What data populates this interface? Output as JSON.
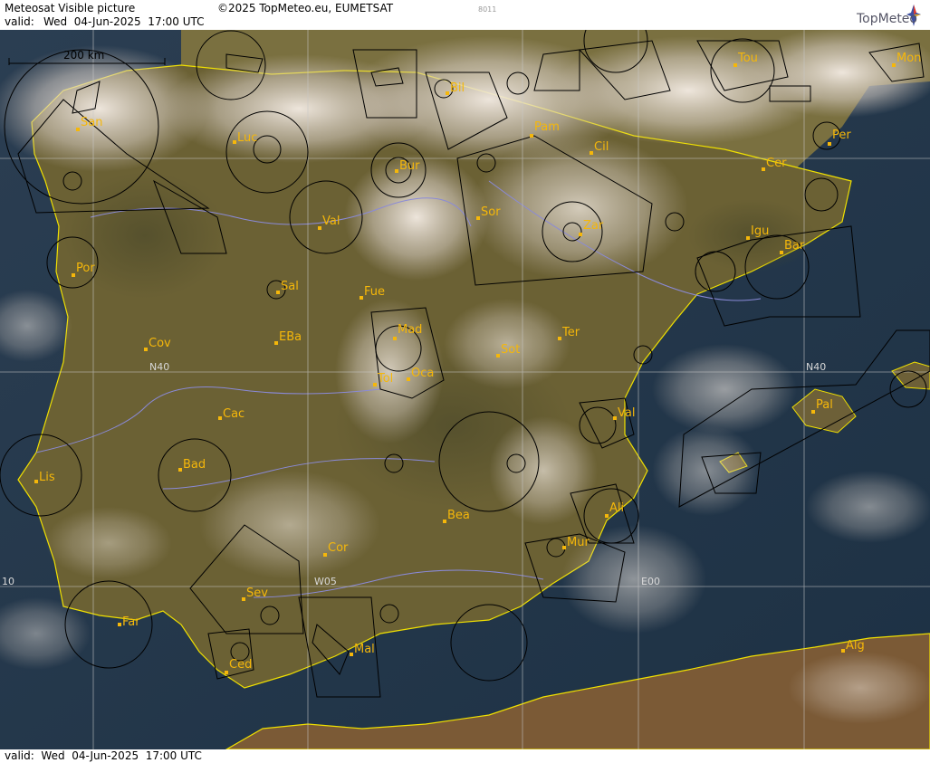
{
  "header": {
    "title": "Meteosat Visible picture",
    "copyright": "©2025 TopMeteo.eu, EUMETSAT",
    "valid_label": "valid:",
    "valid_value": "Wed  04-Jun-2025  17:00 UTC",
    "image_code": "8011",
    "logo_text": "TopMeteo"
  },
  "footer": {
    "valid_text": "valid:  Wed  04-Jun-2025  17:00 UTC"
  },
  "scale_bar": {
    "label": "200 km"
  },
  "grid_labels": {
    "lat_n40": "N40",
    "lat_n40_east": "N40",
    "lon_w05": "W05",
    "lon_e00": "E00",
    "lon_w10": "10"
  },
  "cities": [
    {
      "name": "San"
    },
    {
      "name": "Luc"
    },
    {
      "name": "Bil"
    },
    {
      "name": "Pam"
    },
    {
      "name": "Tou"
    },
    {
      "name": "Mon"
    },
    {
      "name": "Bur"
    },
    {
      "name": "Cil"
    },
    {
      "name": "Per"
    },
    {
      "name": "Cer"
    },
    {
      "name": "Val"
    },
    {
      "name": "Sor"
    },
    {
      "name": "Zar"
    },
    {
      "name": "Igu"
    },
    {
      "name": "Bar"
    },
    {
      "name": "Por"
    },
    {
      "name": "Sal"
    },
    {
      "name": "Fue"
    },
    {
      "name": "Mad"
    },
    {
      "name": "Cov"
    },
    {
      "name": "EBa"
    },
    {
      "name": "Ter"
    },
    {
      "name": "Sot"
    },
    {
      "name": "Tol"
    },
    {
      "name": "Oca"
    },
    {
      "name": "Pal"
    },
    {
      "name": "Cac"
    },
    {
      "name": "Val"
    },
    {
      "name": "Lis"
    },
    {
      "name": "Bad"
    },
    {
      "name": "Ali"
    },
    {
      "name": "Bea"
    },
    {
      "name": "Mur"
    },
    {
      "name": "Cor"
    },
    {
      "name": "Sev"
    },
    {
      "name": "Far"
    },
    {
      "name": "Mal"
    },
    {
      "name": "Ced"
    },
    {
      "name": "Alg"
    }
  ],
  "colors": {
    "sea": "#1f3446",
    "land": "#6e6336",
    "coastline": "#f0e000",
    "city_marker": "#f5b70a",
    "airspace": "#000000",
    "rivers": "#8a8ad8",
    "grid": "#c8c8c8"
  }
}
